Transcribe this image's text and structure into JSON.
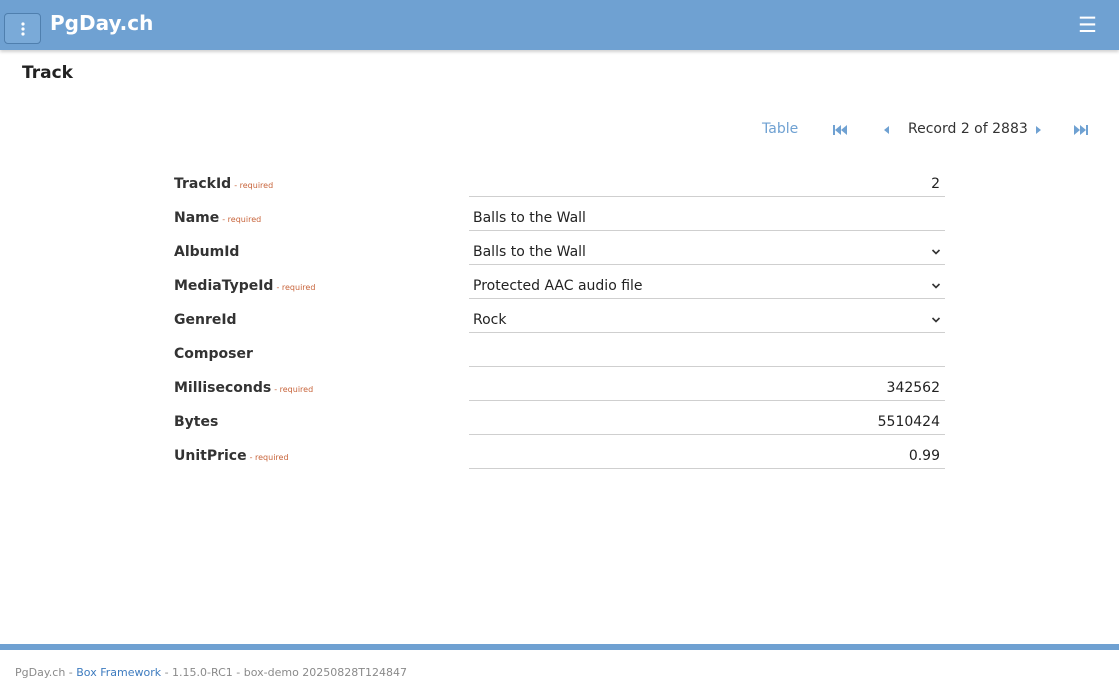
{
  "header": {
    "app_name": "PgDay.ch",
    "menu_icon": "dots-vertical-icon",
    "nav_icon": "hamburger-icon",
    "accent": "#6fa1d2"
  },
  "page": {
    "title": "Track"
  },
  "navigation": {
    "table_label": "Table",
    "record_text": "Record 2 of 2883",
    "icons": [
      "skip-to-first-icon",
      "previous-icon",
      "next-icon",
      "skip-to-last-icon"
    ]
  },
  "form": {
    "required_text": "- required",
    "fields": [
      {
        "label": "TrackId",
        "required": true,
        "value": "2",
        "type": "number"
      },
      {
        "label": "Name",
        "required": true,
        "value": "Balls to the Wall",
        "type": "text"
      },
      {
        "label": "AlbumId",
        "required": false,
        "value": "Balls to the Wall",
        "type": "select"
      },
      {
        "label": "MediaTypeId",
        "required": true,
        "value": "Protected AAC audio file",
        "type": "select"
      },
      {
        "label": "GenreId",
        "required": false,
        "value": "Rock",
        "type": "select"
      },
      {
        "label": "Composer",
        "required": false,
        "value": "",
        "type": "text"
      },
      {
        "label": "Milliseconds",
        "required": true,
        "value": "342562",
        "type": "number"
      },
      {
        "label": "Bytes",
        "required": false,
        "value": "5510424",
        "type": "number"
      },
      {
        "label": "UnitPrice",
        "required": true,
        "value": "0.99",
        "type": "number"
      }
    ]
  },
  "footer": {
    "prefix": "PgDay.ch - ",
    "link": "Box Framework",
    "suffix": " - 1.15.0-RC1 - box-demo 20250828T124847"
  }
}
